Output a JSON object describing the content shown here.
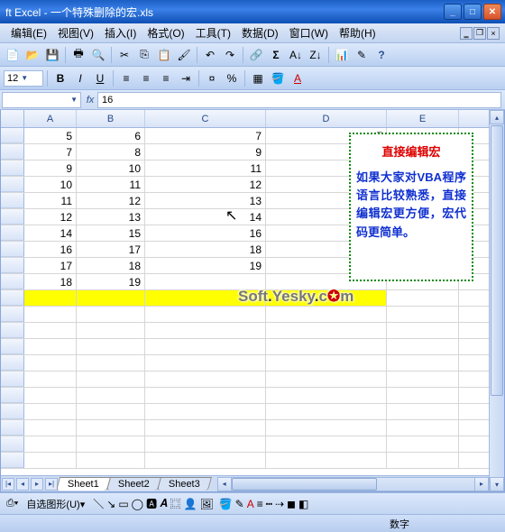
{
  "window": {
    "title": "ft Excel - 一个特殊删除的宏.xls"
  },
  "menu": {
    "items": [
      "编辑(E)",
      "视图(V)",
      "插入(I)",
      "格式(O)",
      "工具(T)",
      "数据(D)",
      "窗口(W)",
      "帮助(H)"
    ]
  },
  "format_bar": {
    "font_size": "12"
  },
  "namebox": {
    "cell_ref": "",
    "formula": "16"
  },
  "columns": [
    "A",
    "B",
    "C",
    "D",
    "E"
  ],
  "rows": [
    {
      "A": "5",
      "B": "6",
      "C": "7",
      "D": "7",
      "E": ""
    },
    {
      "A": "7",
      "B": "8",
      "C": "9",
      "D": "",
      "E": ""
    },
    {
      "A": "9",
      "B": "10",
      "C": "11",
      "D": "",
      "E": ""
    },
    {
      "A": "10",
      "B": "11",
      "C": "12",
      "D": "",
      "E": ""
    },
    {
      "A": "11",
      "B": "12",
      "C": "13",
      "D": "",
      "E": ""
    },
    {
      "A": "12",
      "B": "13",
      "C": "14",
      "D": "",
      "E": ""
    },
    {
      "A": "14",
      "B": "15",
      "C": "16",
      "D": "",
      "E": ""
    },
    {
      "A": "16",
      "B": "17",
      "C": "18",
      "D": "",
      "E": ""
    },
    {
      "A": "17",
      "B": "18",
      "C": "19",
      "D": "",
      "E": ""
    },
    {
      "A": "18",
      "B": "19",
      "C": "",
      "D": "",
      "E": ""
    },
    {
      "A": "",
      "B": "",
      "C": "",
      "D": "",
      "E": "",
      "yellow": true
    },
    {
      "A": "",
      "B": "",
      "C": "",
      "D": "",
      "E": ""
    },
    {
      "A": "",
      "B": "",
      "C": "",
      "D": "",
      "E": ""
    },
    {
      "A": "",
      "B": "",
      "C": "",
      "D": "",
      "E": ""
    },
    {
      "A": "",
      "B": "",
      "C": "",
      "D": "",
      "E": ""
    },
    {
      "A": "",
      "B": "",
      "C": "",
      "D": "",
      "E": ""
    },
    {
      "A": "",
      "B": "",
      "C": "",
      "D": "",
      "E": ""
    },
    {
      "A": "",
      "B": "",
      "C": "",
      "D": "",
      "E": ""
    },
    {
      "A": "",
      "B": "",
      "C": "",
      "D": "",
      "E": ""
    },
    {
      "A": "",
      "B": "",
      "C": "",
      "D": "",
      "E": ""
    },
    {
      "A": "",
      "B": "",
      "C": "",
      "D": "",
      "E": ""
    }
  ],
  "callout": {
    "title": "直接编辑宏",
    "body": "如果大家对VBA程序语言比较熟悉，直接编辑宏更方便，宏代码更简单。"
  },
  "watermark": {
    "t1": "Soft",
    "dot1": ".",
    "t2": "Yesky",
    "dot2": ".",
    "t3": "c",
    "icon": "✪",
    "t4": "m"
  },
  "sheet_tabs": {
    "tabs": [
      "Sheet1",
      "Sheet2",
      "Sheet3"
    ],
    "active": 0
  },
  "drawbar": {
    "label": "自选图形(U)"
  },
  "statusbar": {
    "mode": "数字"
  }
}
